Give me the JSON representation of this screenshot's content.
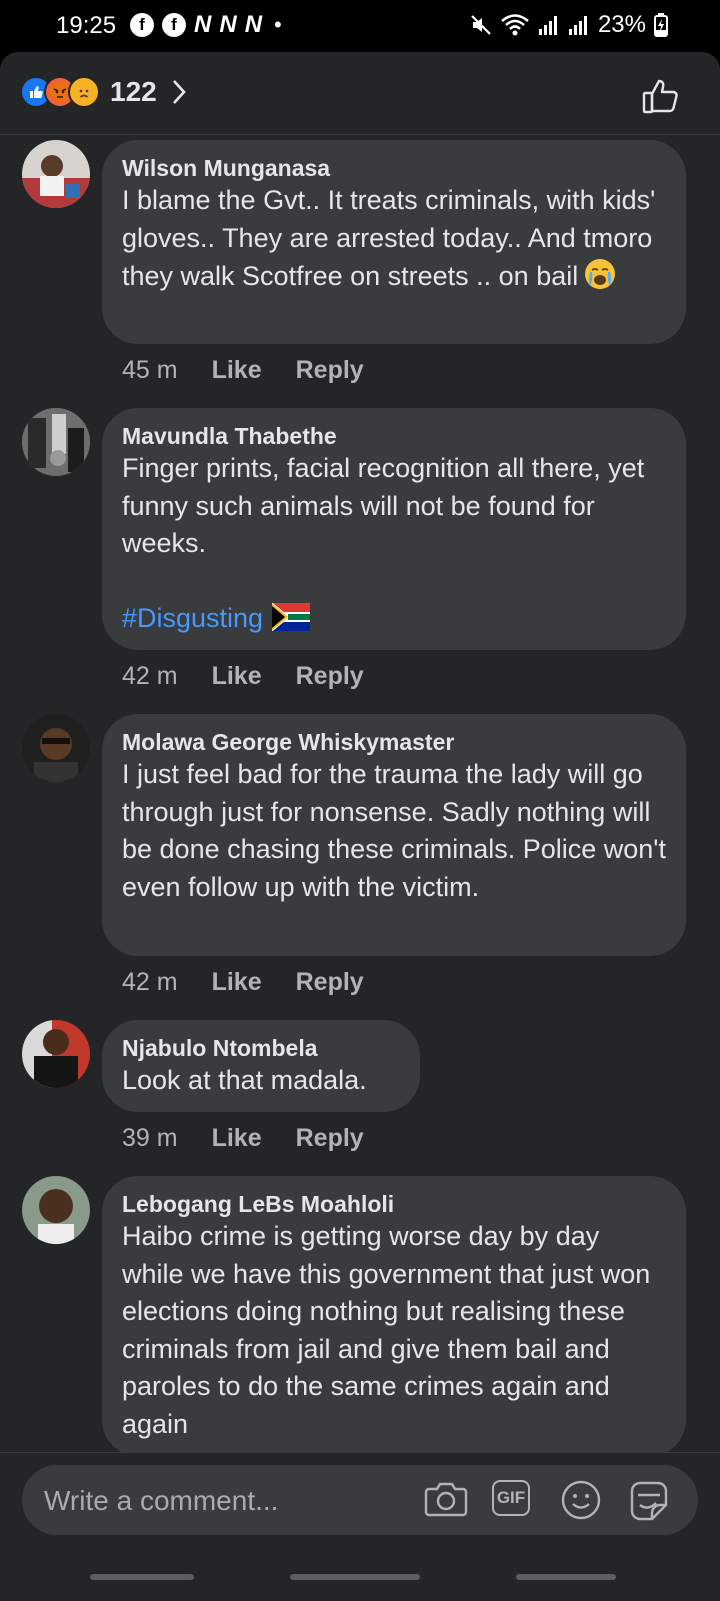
{
  "status_bar": {
    "time": "19:25",
    "notification_icons": [
      "facebook-icon",
      "facebook-icon",
      "news24-icon",
      "news24-icon",
      "news24-icon"
    ],
    "notif_letters": [
      "f",
      "f",
      "N",
      "N",
      "N"
    ],
    "battery": "23%"
  },
  "header": {
    "reaction_types": [
      "like",
      "angry",
      "sad"
    ],
    "reaction_count": "122"
  },
  "comments": [
    {
      "name": "Wilson Munganasa",
      "text": "I blame the Gvt.. It treats criminals, with kids' gloves.. They are arrested today.. And tmoro they walk Scotfree on streets .. on bail",
      "emoji": "crying-face",
      "time": "45 m",
      "like": "Like",
      "reply": "Reply"
    },
    {
      "name": "Mavundla Thabethe",
      "text": "Finger prints, facial recognition all there, yet funny such animals will not be found for weeks.",
      "hashtag": "#Disgusting",
      "emoji": "south-africa-flag",
      "time": "42 m",
      "like": "Like",
      "reply": "Reply"
    },
    {
      "name": "Molawa George Whiskymaster",
      "text": "I just feel bad for the trauma the lady will go through just for nonsense. Sadly nothing will be done chasing these criminals. Police won't even follow up with the victim.",
      "time": "42 m",
      "like": "Like",
      "reply": "Reply"
    },
    {
      "name": "Njabulo Ntombela",
      "text": "Look at that madala.",
      "time": "39 m",
      "like": "Like",
      "reply": "Reply"
    },
    {
      "name": "Lebogang LeBs Moahloli",
      "text": "Haibo crime is getting worse day by day while we have this government that just won elections doing nothing but realising these criminals from jail and give them bail and paroles to do the same crimes again and again"
    }
  ],
  "composer": {
    "placeholder": "Write a comment...",
    "gif_label": "GIF"
  },
  "colors": {
    "background": "#242526",
    "bubble": "#3a3b3c",
    "text": "#e4e6eb",
    "secondary_text": "#b0b3b8",
    "hashtag": "#4599ff",
    "like_blue": "#1877f2"
  }
}
